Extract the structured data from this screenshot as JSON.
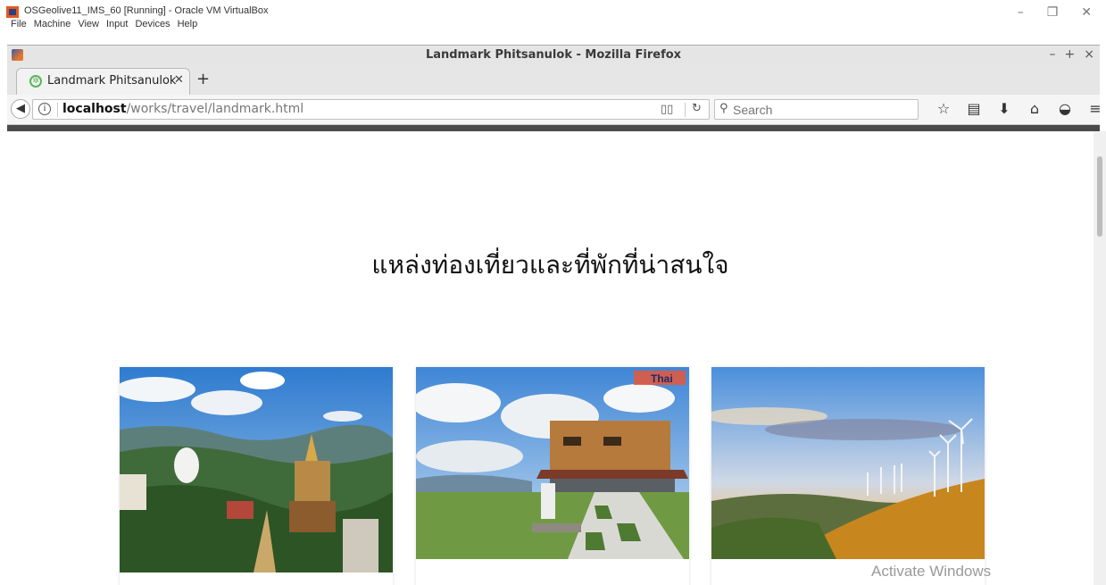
{
  "vbox": {
    "title": "OSGeolive11_IMS_60 [Running] - Oracle VM VirtualBox",
    "menu": [
      "File",
      "Machine",
      "View",
      "Input",
      "Devices",
      "Help"
    ]
  },
  "firefox": {
    "window_title": "Landmark Phitsanulok - Mozilla Firefox",
    "tab_label": "Landmark Phitsanulok",
    "url_host": "localhost",
    "url_path": "/works/travel/landmark.html",
    "search_placeholder": "Search"
  },
  "page": {
    "heading": "แหล่งท่องเที่ยวและที่พักที่น่าสนใจ",
    "cards": [
      {
        "image": "temple-on-mountain-photo"
      },
      {
        "image": "mountain-cafe-photo",
        "watermark": "Thai"
      },
      {
        "image": "wind-turbines-hill-photo"
      }
    ]
  },
  "overlay": {
    "activate_text": "Activate Windows"
  },
  "colors": {
    "tab_favicon": "#58b55a",
    "heading_text": "#111111",
    "sky_blue": "#3f86d6"
  }
}
